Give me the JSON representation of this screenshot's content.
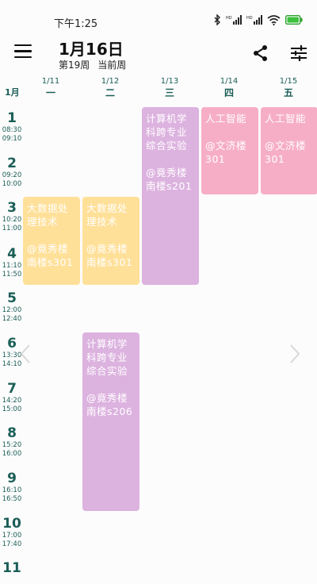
{
  "status_bar": {
    "time": "下午1:25"
  },
  "header": {
    "date": "1月16日",
    "week": "第19周",
    "week_state": "当前周"
  },
  "month_label": "1月",
  "days": [
    {
      "date": "1/11",
      "weekday": "一"
    },
    {
      "date": "1/12",
      "weekday": "二"
    },
    {
      "date": "1/13",
      "weekday": "三"
    },
    {
      "date": "1/14",
      "weekday": "四"
    },
    {
      "date": "1/15",
      "weekday": "五"
    }
  ],
  "slots": [
    {
      "n": "1",
      "start": "08:30",
      "end": "09:10"
    },
    {
      "n": "2",
      "start": "09:20",
      "end": "10:00"
    },
    {
      "n": "3",
      "start": "10:20",
      "end": "11:00"
    },
    {
      "n": "4",
      "start": "11:10",
      "end": "11:50"
    },
    {
      "n": "5",
      "start": "12:00",
      "end": "12:40"
    },
    {
      "n": "6",
      "start": "13:30",
      "end": "14:10"
    },
    {
      "n": "7",
      "start": "14:20",
      "end": "15:00"
    },
    {
      "n": "8",
      "start": "15:20",
      "end": "16:00"
    },
    {
      "n": "9",
      "start": "16:10",
      "end": "16:50"
    },
    {
      "n": "10",
      "start": "17:00",
      "end": "17:40"
    },
    {
      "n": "11",
      "start": "",
      "end": ""
    }
  ],
  "courses": [
    {
      "name": "大数据处理技术",
      "location": "@竟秀楼南楼s301",
      "color": "#ffe099"
    },
    {
      "name": "大数据处理技术",
      "location": "@竟秀楼南楼s301",
      "color": "#ffe099"
    },
    {
      "name": "计算机学科跨专业综合实验",
      "location": "@竟秀楼南楼s201",
      "color": "#dcb2df"
    },
    {
      "name": "人工智能",
      "location": "@文济楼301",
      "color": "#f6aec6"
    },
    {
      "name": "人工智能",
      "location": "@文济楼301",
      "color": "#f6aec6"
    },
    {
      "name": "计算机学科跨专业综合实验",
      "location": "@竟秀楼南楼s206",
      "color": "#dcb2df"
    }
  ],
  "icons": {
    "menu": "menu-icon",
    "share": "share-icon",
    "settings": "tune-icon",
    "prev": "chevron-left-icon",
    "next": "chevron-right-icon"
  }
}
